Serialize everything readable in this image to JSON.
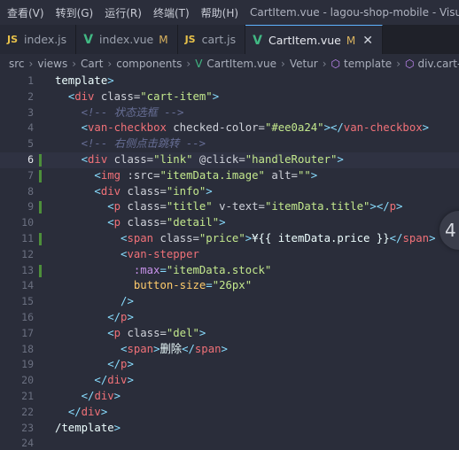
{
  "menu": [
    "查看(V)",
    "转到(G)",
    "运行(R)",
    "终端(T)",
    "帮助(H)"
  ],
  "window_title": "CartItem.vue - lagou-shop-mobile - Visua",
  "tabs": [
    {
      "name": "index.js",
      "icon": "js-icon",
      "icon_text": "JS",
      "modified": ""
    },
    {
      "name": "index.vue",
      "icon": "vue-icon",
      "icon_text": "V",
      "modified": "M"
    },
    {
      "name": "cart.js",
      "icon": "js-icon",
      "icon_text": "JS",
      "modified": ""
    },
    {
      "name": "CartItem.vue",
      "icon": "vue-icon",
      "icon_text": "V",
      "modified": "M",
      "close": "✕"
    }
  ],
  "breadcrumb": {
    "parts": [
      "src",
      "views",
      "Cart",
      "components"
    ],
    "file": "CartItem.vue",
    "extra": "Vetur",
    "sym1": "template",
    "sym2": "div.cart-item"
  },
  "float_button": "4",
  "code_lines": [
    {
      "n": "1",
      "text": "template>"
    },
    {
      "n": "2",
      "text": "  <div class=\"cart-item\">"
    },
    {
      "n": "3",
      "text": "    <!-- 状态选框 -->"
    },
    {
      "n": "4",
      "text": "    <van-checkbox checked-color=\"#ee0a24\"></van-checkbox>"
    },
    {
      "n": "5",
      "text": "    <!-- 右侧点击跳转 -->"
    },
    {
      "n": "6",
      "text": "    <div class=\"link\" @click=\"handleRouter\">"
    },
    {
      "n": "7",
      "text": "      <img :src=\"itemData.image\" alt=\"\">"
    },
    {
      "n": "8",
      "text": "      <div class=\"info\">"
    },
    {
      "n": "9",
      "text": "        <p class=\"title\" v-text=\"itemData.title\"></p>"
    },
    {
      "n": "10",
      "text": "        <p class=\"detail\">"
    },
    {
      "n": "11",
      "text": "          <span class=\"price\">¥{{ itemData.price }}</span>"
    },
    {
      "n": "12",
      "text": "          <van-stepper"
    },
    {
      "n": "13",
      "text": "            :max=\"itemData.stock\""
    },
    {
      "n": "14",
      "text": "            button-size=\"26px\""
    },
    {
      "n": "15",
      "text": "          />"
    },
    {
      "n": "16",
      "text": "        </p>"
    },
    {
      "n": "17",
      "text": "        <p class=\"del\">"
    },
    {
      "n": "18",
      "text": "          <span>删除</span>"
    },
    {
      "n": "19",
      "text": "        </p>"
    },
    {
      "n": "20",
      "text": "      </div>"
    },
    {
      "n": "21",
      "text": "    </div>"
    },
    {
      "n": "22",
      "text": "  </div>"
    },
    {
      "n": "23",
      "text": "/template>"
    },
    {
      "n": "24",
      "text": ""
    }
  ],
  "current_line": "6",
  "modified_lines": [
    "6",
    "7",
    "9",
    "11",
    "13"
  ]
}
